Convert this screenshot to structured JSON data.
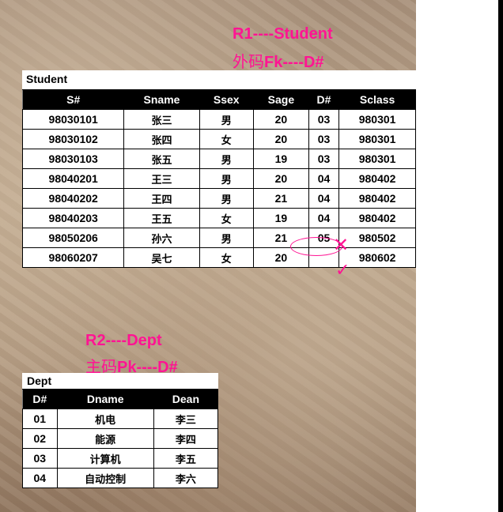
{
  "r1": {
    "title": "R1----Student",
    "sub_prefix": "外码",
    "sub_key": "Fk----D#"
  },
  "student_table": {
    "label": "Student",
    "headers": [
      "S#",
      "Sname",
      "Ssex",
      "Sage",
      "D#",
      "Sclass"
    ],
    "rows": [
      [
        "98030101",
        "张三",
        "男",
        "20",
        "03",
        "980301"
      ],
      [
        "98030102",
        "张四",
        "女",
        "20",
        "03",
        "980301"
      ],
      [
        "98030103",
        "张五",
        "男",
        "19",
        "03",
        "980301"
      ],
      [
        "98040201",
        "王三",
        "男",
        "20",
        "04",
        "980402"
      ],
      [
        "98040202",
        "王四",
        "男",
        "21",
        "04",
        "980402"
      ],
      [
        "98040203",
        "王五",
        "女",
        "19",
        "04",
        "980402"
      ],
      [
        "98050206",
        "孙六",
        "男",
        "21",
        "05",
        "980502"
      ],
      [
        "98060207",
        "吴七",
        "女",
        "20",
        "",
        "980602"
      ]
    ]
  },
  "marks": {
    "cross": "✕",
    "check": "✓"
  },
  "r2": {
    "title": "R2----Dept",
    "sub_prefix": "主码",
    "sub_key": "Pk----D#"
  },
  "dept_table": {
    "label": "Dept",
    "headers": [
      "D#",
      "Dname",
      "Dean"
    ],
    "rows": [
      [
        "01",
        "机电",
        "李三"
      ],
      [
        "02",
        "能源",
        "李四"
      ],
      [
        "03",
        "计算机",
        "李五"
      ],
      [
        "04",
        "自动控制",
        "李六"
      ]
    ]
  }
}
